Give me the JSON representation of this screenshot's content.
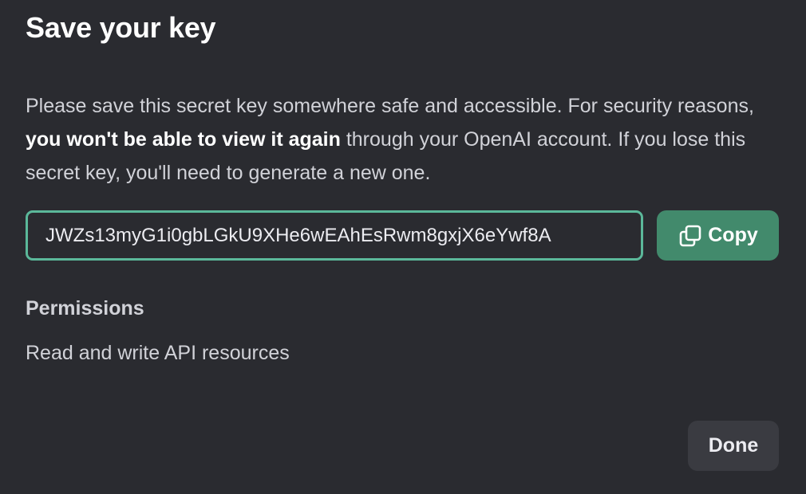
{
  "dialog": {
    "title": "Save your key",
    "description": {
      "part1": "Please save this secret key somewhere safe and accessible. For security reasons, ",
      "emphasis": "you won't be able to view it again",
      "part2": " through your OpenAI account. If you lose this secret key, you'll need to generate a new one."
    },
    "key_field": {
      "value": "JWZs13myG1i0gbLGkU9XHe6wEAhEsRwm8gxjX6eYwf8A"
    },
    "copy_button": {
      "label": "Copy",
      "icon": "copy-icon"
    },
    "permissions": {
      "heading": "Permissions",
      "value": "Read and write API resources"
    },
    "done_button": {
      "label": "Done"
    }
  },
  "colors": {
    "background": "#2a2b30",
    "accent": "#428a6c",
    "focus_border": "#5bb89a",
    "secondary_button": "#3a3b41"
  }
}
